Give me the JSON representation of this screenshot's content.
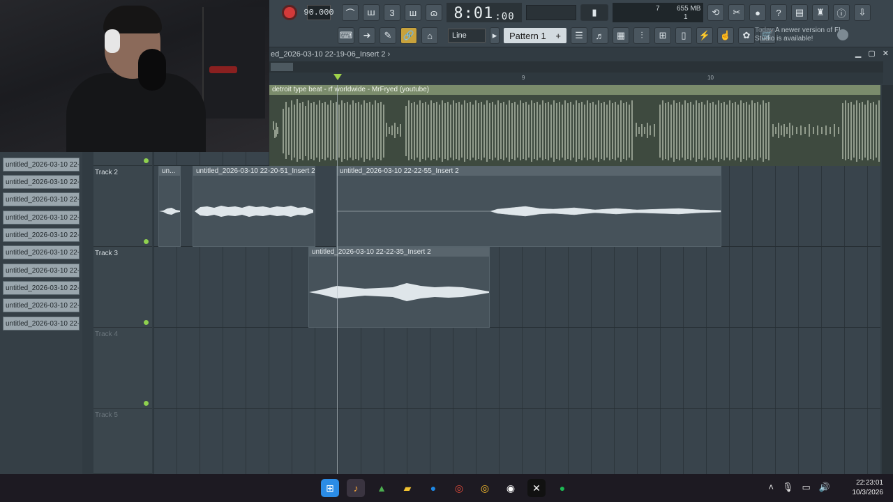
{
  "toolbar": {
    "tempo": "90.000",
    "time_main": "8:01",
    "time_sub": ":00",
    "cpu_value": "7",
    "memory": "655 MB",
    "voices": "1",
    "snap_mode": "Line",
    "pattern": "Pattern 1",
    "pattern_add": "+",
    "notice_prefix": "Today",
    "notice_text": "A newer version of FL Studio is available!"
  },
  "playlist": {
    "title": "ed_2026-03-10 22-19-06_Insert 2",
    "title_arrow": "›",
    "ruler": [
      {
        "label": "9"
      },
      {
        "label": "10"
      }
    ]
  },
  "picker": [
    "untitled_2026-03-10 22-...",
    "untitled_2026-03-10 22-...",
    "untitled_2026-03-10 22-...",
    "untitled_2026-03-10 22-...",
    "untitled_2026-03-10 22-...",
    "untitled_2026-03-10 22-...",
    "untitled_2026-03-10 22-...",
    "untitled_2026-03-10 22-...",
    "untitled_2026-03-10 22-...",
    "untitled_2026-03-10 22-..."
  ],
  "tracks": [
    {
      "label": "Track 2"
    },
    {
      "label": "Track 3"
    },
    {
      "label": "Track 4"
    },
    {
      "label": "Track 5"
    }
  ],
  "clips": {
    "beat": "detroit type beat - rf worldwide - MrFryed (youtube)",
    "t2_a": "un...",
    "t2_b": "untitled_2026-03-10 22-20-51_Insert 2",
    "t2_c": "untitled_2026-03-10 22-22-55_Insert 2",
    "t3_a": "untitled_2026-03-10 22-22-35_Insert 2"
  },
  "taskbar": {
    "time": "22:23:01",
    "date": "10/3/2026"
  },
  "colors": {
    "accent": "#9fd24a",
    "record": "#d23a3a",
    "link_active": "#c8a23c"
  }
}
